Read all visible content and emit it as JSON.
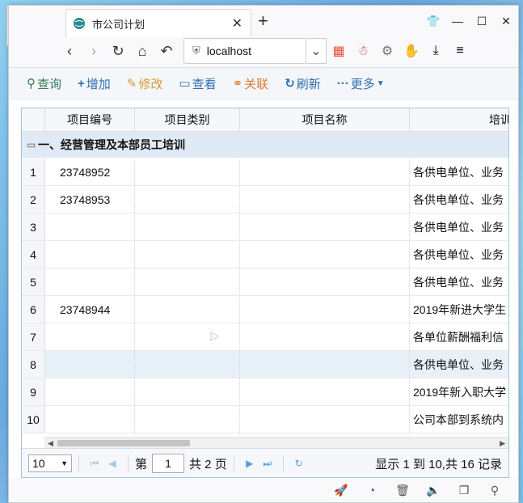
{
  "browser": {
    "tab_title": "市公司计划",
    "url": "localhost"
  },
  "toolbar": {
    "query": "查询",
    "add": "增加",
    "edit": "修改",
    "view": "查看",
    "link": "关联",
    "refresh": "刷新",
    "more": "更多"
  },
  "grid": {
    "columns": [
      "项目编号",
      "项目类别",
      "项目名称",
      "培训"
    ],
    "group_title": "一、经营管理及本部员工培训",
    "rows": [
      {
        "n": "1",
        "code": "23748952",
        "type": "",
        "name": "",
        "train": "各供电单位、业务"
      },
      {
        "n": "2",
        "code": "23748953",
        "type": "",
        "name": "",
        "train": "各供电单位、业务"
      },
      {
        "n": "3",
        "code": "",
        "type": "",
        "name": "",
        "train": "各供电单位、业务"
      },
      {
        "n": "4",
        "code": "",
        "type": "",
        "name": "",
        "train": "各供电单位、业务"
      },
      {
        "n": "5",
        "code": "",
        "type": "",
        "name": "",
        "train": "各供电单位、业务"
      },
      {
        "n": "6",
        "code": "23748944",
        "type": "",
        "name": "",
        "train": "2019年新进大学生"
      },
      {
        "n": "7",
        "code": "",
        "type": "",
        "name": "",
        "train": "各单位薪酬福利信"
      },
      {
        "n": "8",
        "code": "",
        "type": "",
        "name": "",
        "train": "各供电单位、业务"
      },
      {
        "n": "9",
        "code": "",
        "type": "",
        "name": "",
        "train": "2019年新入职大学"
      },
      {
        "n": "10",
        "code": "",
        "type": "",
        "name": "",
        "train": "公司本部到系统内"
      }
    ]
  },
  "pager": {
    "page_size": "10",
    "page_prefix": "第",
    "page_value": "1",
    "page_suffix": "共 2 页",
    "info": "显示 1 到 10,共 16 记录"
  }
}
